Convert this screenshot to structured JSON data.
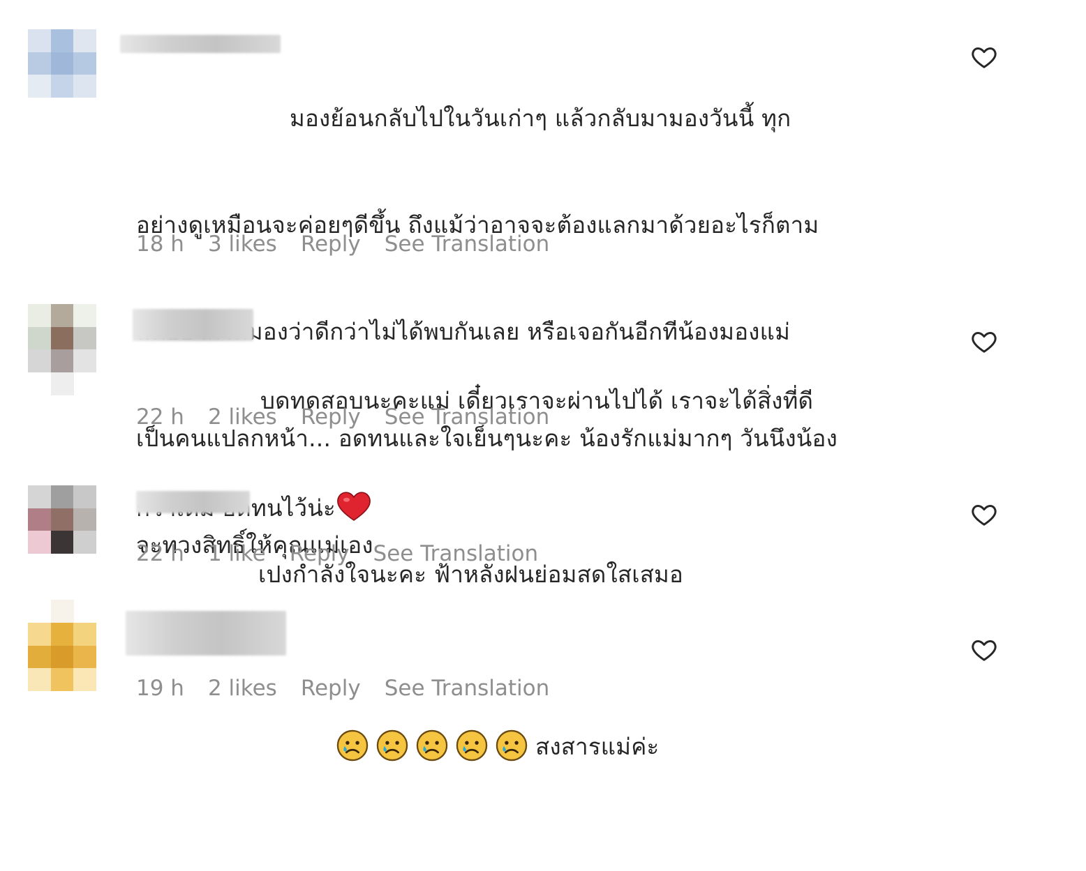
{
  "comments": [
    {
      "lines": [
        "มองย้อนกลับไปในวันเก่าๆ แล้วกลับมามองวันนี้ ทุก",
        "อย่างดูเหมือนจะค่อยๆดีขึ้น ถึงแม้ว่าอาจจะต้องแลกมาด้วยอะไรก็ตาม",
        "แต่อยากให้มองว่าดีกว่าไม่ได้พบกันเลย หรือเจอกันอีกทีน้องมองแม่",
        "เป็นคนแปลกหน้า... อดทนและใจเย็นๆนะคะ น้องรักแม่มากๆ วันนึงน้อง",
        "จะทวงสิทธิ์ให้คุณแม่เอง"
      ],
      "time": "18 h",
      "likes": "3 likes",
      "reply": "Reply",
      "translate": "See Translation",
      "like_icon": "heart-outline-icon"
    },
    {
      "lines": [
        "บดทดสอบนะคะแม่ เดี๋ยวเราจะผ่านไปได้ เราจะได้สิ่งที่ดี",
        "กว่าเดิม อดทนไว้น่ะ"
      ],
      "emoji": "red-heart-emoji",
      "time": "22 h",
      "likes": "2 likes",
      "reply": "Reply",
      "translate": "See Translation",
      "like_icon": "heart-outline-icon"
    },
    {
      "lines": [
        "เปงกำลังใจนะคะ ฟ้าหลังฝนย่อมสดใสเสมอ"
      ],
      "time": "22 h",
      "likes": "1 like",
      "reply": "Reply",
      "translate": "See Translation",
      "like_icon": "heart-outline-icon"
    },
    {
      "lines": [
        "สงสารแม่ค่ะ"
      ],
      "emoji": "sad-face-emoji",
      "emoji_count": 5,
      "time": "19 h",
      "likes": "2 likes",
      "reply": "Reply",
      "translate": "See Translation",
      "like_icon": "heart-outline-icon"
    }
  ],
  "colors": {
    "text": "#262626",
    "meta": "#8e8e8e",
    "heart_emoji": "#e0242f",
    "sad_emoji": "#f5c542"
  }
}
